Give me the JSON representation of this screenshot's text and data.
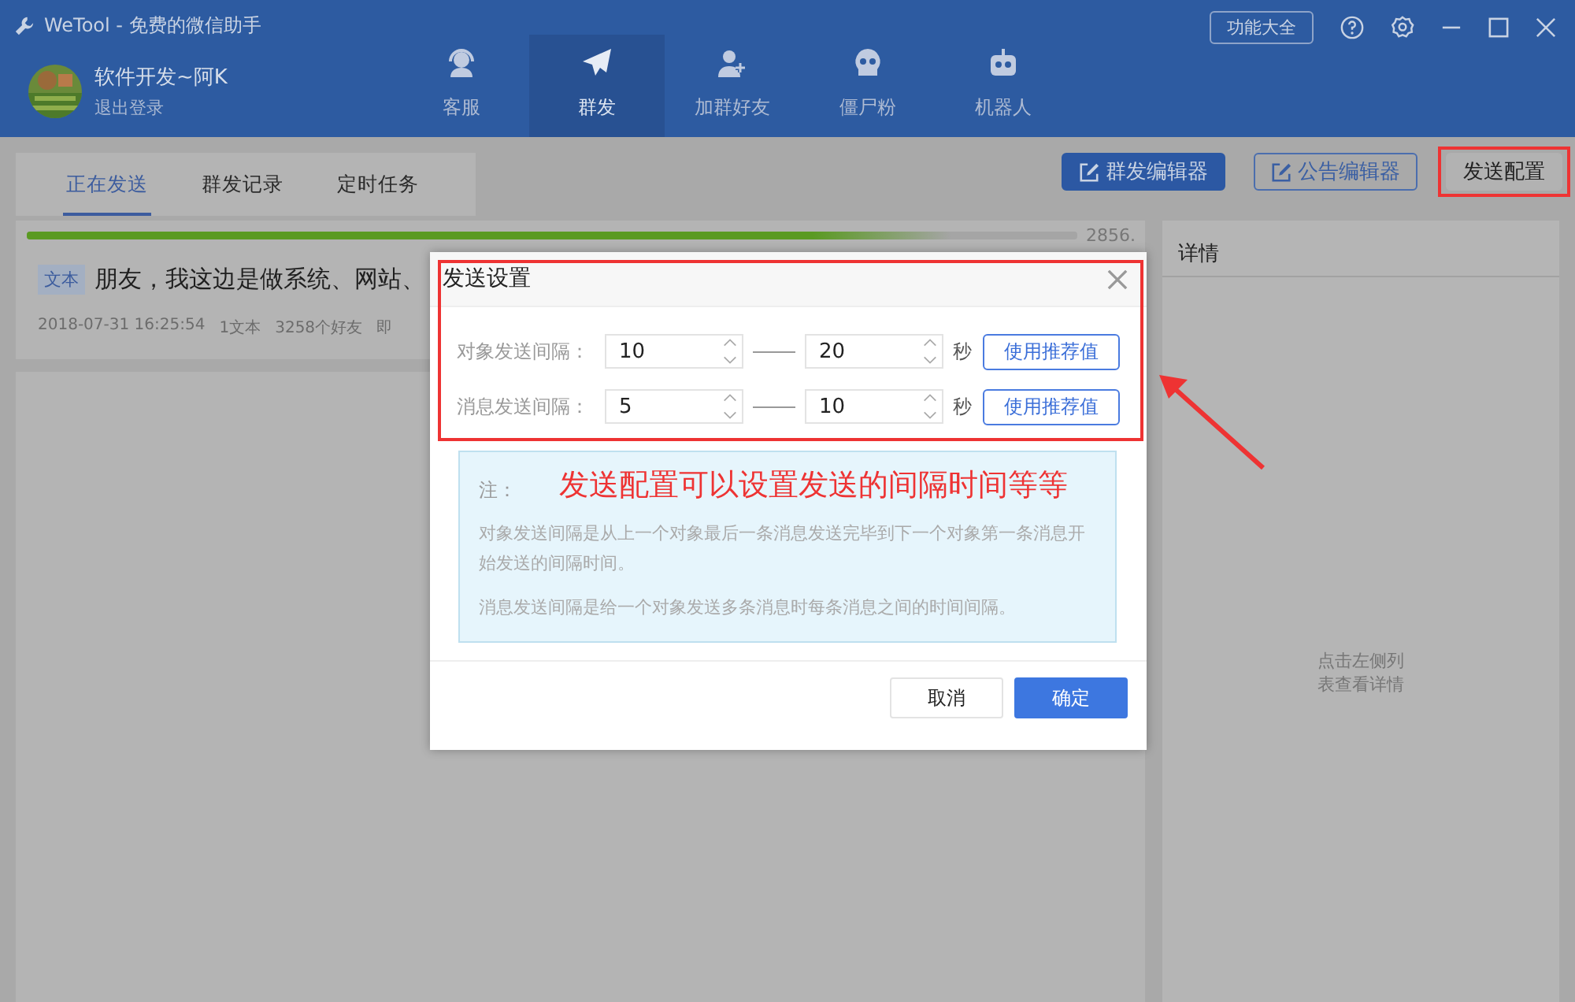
{
  "window": {
    "title": "WeTool - 免费的微信助手",
    "feature_button": "功能大全"
  },
  "user": {
    "name": "软件开发~阿K",
    "action": "退出登录"
  },
  "nav": [
    {
      "label": "客服",
      "selected": false
    },
    {
      "label": "群发",
      "selected": true
    },
    {
      "label": "加群好友",
      "selected": false
    },
    {
      "label": "僵尸粉",
      "selected": false
    },
    {
      "label": "机器人",
      "selected": false
    }
  ],
  "tabs": [
    {
      "label": "正在发送",
      "selected": true
    },
    {
      "label": "群发记录",
      "selected": false
    },
    {
      "label": "定时任务",
      "selected": false
    }
  ],
  "toolbar": [
    {
      "label": "群发编辑器",
      "kind": "filled",
      "annotated": false
    },
    {
      "label": "公告编辑器",
      "kind": "outlined",
      "annotated": false
    },
    {
      "label": "发送配置",
      "kind": "plain",
      "annotated": true
    }
  ],
  "progress": {
    "level": 0.88,
    "reading": "2856."
  },
  "message": {
    "tag": "文本",
    "text": "朋友，我这边是做系统、网站、",
    "meta": [
      "2018-07-31 16:25:54",
      "1文本",
      "3258个好友",
      "即"
    ]
  },
  "details": {
    "title": "详情",
    "hint": "点击左侧列表查看详情"
  },
  "dialog": {
    "title": "发送设置",
    "annotated": true,
    "rows": [
      {
        "label": "对象发送间隔：",
        "from": "10",
        "to": "20",
        "unit": "秒",
        "button": "使用推荐值"
      },
      {
        "label": "消息发送间隔：",
        "from": "5",
        "to": "10",
        "unit": "秒",
        "button": "使用推荐值"
      }
    ],
    "note": {
      "title": "注：",
      "paragraphs": [
        "对象发送间隔是从上一个对象最后一条消息发送完毕到下一个对象第一条消息开始发送的间隔时间。",
        "消息发送间隔是给一个对象发送多条消息时每条消息之间的时间间隔。"
      ]
    },
    "buttons": [
      {
        "label": "取消",
        "kind": "secondary"
      },
      {
        "label": "确定",
        "kind": "primary"
      }
    ]
  },
  "annotation": {
    "text": "发送配置可以设置发送的间隔时间等等"
  }
}
